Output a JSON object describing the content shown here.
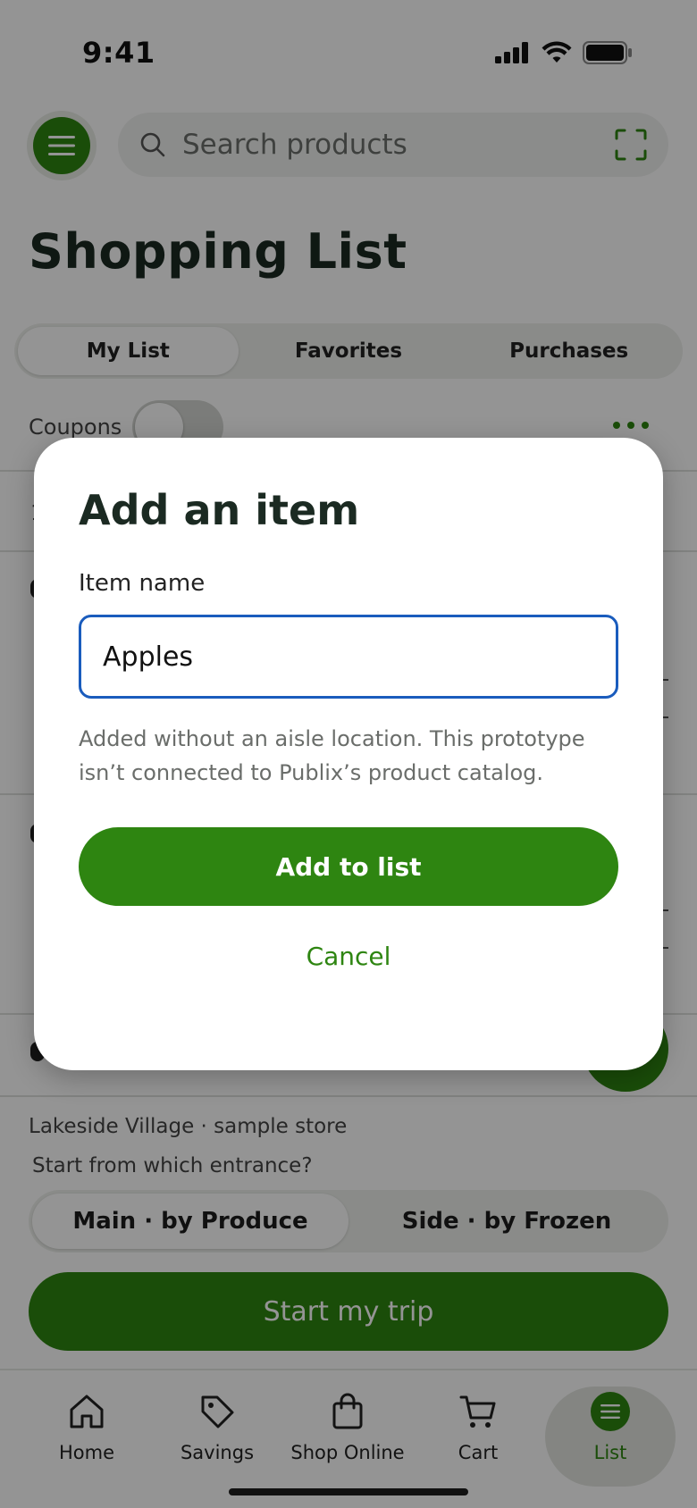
{
  "status_bar": {
    "time": "9:41"
  },
  "header": {
    "search_placeholder": "Search products"
  },
  "page_title": "Shopping List",
  "tabs": [
    {
      "label": "My List",
      "active": true
    },
    {
      "label": "Favorites",
      "active": false
    },
    {
      "label": "Purchases",
      "active": false
    }
  ],
  "coupons": {
    "label": "Coupons",
    "enabled": false
  },
  "list_peek": {
    "count_fragment": "1"
  },
  "store": {
    "line": "Lakeside Village · sample store",
    "entrance_question": "Start from which entrance?",
    "entrances": [
      {
        "label": "Main · by Produce",
        "selected": true
      },
      {
        "label": "Side · by Frozen",
        "selected": false
      }
    ],
    "start_button": "Start my trip"
  },
  "bottom_nav": [
    {
      "label": "Home",
      "icon": "home-icon",
      "active": false
    },
    {
      "label": "Savings",
      "icon": "tag-icon",
      "active": false
    },
    {
      "label": "Shop Online",
      "icon": "shopping-bag-icon",
      "active": false
    },
    {
      "label": "Cart",
      "icon": "cart-icon",
      "active": false
    },
    {
      "label": "List",
      "icon": "list-icon",
      "active": true
    }
  ],
  "modal": {
    "title": "Add an item",
    "field_label": "Item name",
    "field_value": "Apples",
    "note": "Added without an aisle location. This prototype isn’t connected to Publix’s product catalog.",
    "add_button": "Add to list",
    "cancel_button": "Cancel"
  },
  "colors": {
    "brand_green": "#2e8511",
    "focus_blue": "#1a5cbd",
    "scrim": "rgba(0,0,0,0.42)"
  }
}
